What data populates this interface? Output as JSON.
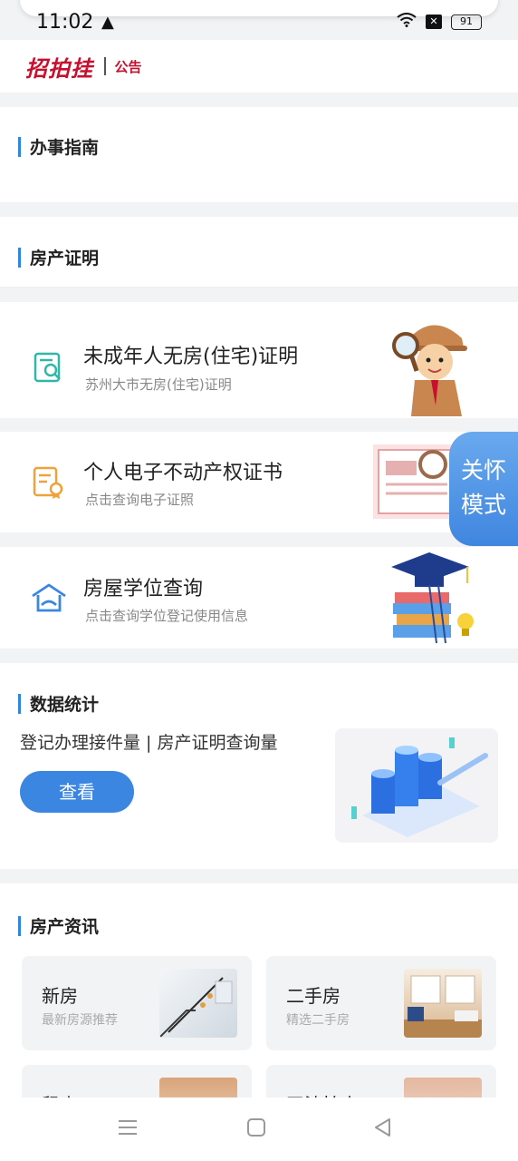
{
  "status_bar": {
    "time": "11:02",
    "battery": "91"
  },
  "header": {
    "logo": "招拍挂",
    "notice": "公告"
  },
  "sections": {
    "guide": "办事指南",
    "property_cert": "房产证明",
    "stats": "数据统计",
    "news": "房产资讯"
  },
  "services": [
    {
      "title": "未成年人无房(住宅)证明",
      "subtitle": "苏州大市无房(住宅)证明",
      "icon": "document-search-icon"
    },
    {
      "title": "个人电子不动产权证书",
      "subtitle": "点击查询电子证照",
      "icon": "certificate-icon"
    },
    {
      "title": "房屋学位查询",
      "subtitle": "点击查询学位登记使用信息",
      "icon": "school-house-icon"
    }
  ],
  "care_mode": {
    "line1": "关怀",
    "line2": "模式"
  },
  "stats": {
    "description": "登记办理接件量 | 房产证明查询量",
    "button": "查看"
  },
  "news": [
    {
      "title": "新房",
      "subtitle": "最新房源推荐"
    },
    {
      "title": "二手房",
      "subtitle": "精选二手房"
    },
    {
      "title": "租房",
      "subtitle": ""
    },
    {
      "title": "司法拍卖",
      "subtitle": ""
    }
  ],
  "colors": {
    "accent": "#3a86e0",
    "brand_red": "#c8102e",
    "section_bar": "#2e86de"
  }
}
